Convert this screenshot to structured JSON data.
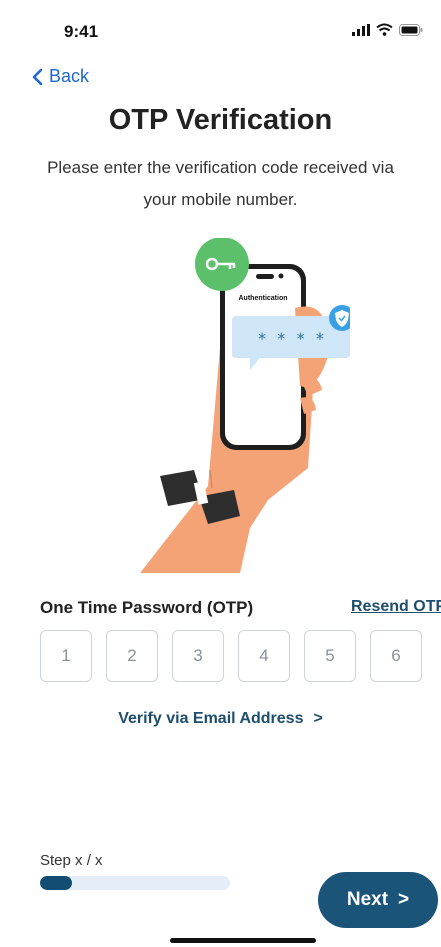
{
  "status_bar": {
    "time": "9:41"
  },
  "nav": {
    "back_label": "Back"
  },
  "header": {
    "title": "OTP Verification",
    "subtitle": "Please enter the verification code received via your mobile number."
  },
  "illustration": {
    "screen_title": "Authentication",
    "masked_code": "* * * *"
  },
  "otp": {
    "label": "One Time Password (OTP)",
    "resend_label": "Resend OTP",
    "digits": [
      "1",
      "2",
      "3",
      "4",
      "5",
      "6"
    ]
  },
  "verify_email": {
    "label": "Verify via Email Address",
    "chevron": ">"
  },
  "footer": {
    "step_label": "Step x / x",
    "progress": 0.17,
    "next_label": "Next",
    "next_chevron": ">"
  },
  "colors": {
    "accent": "#1a5478",
    "link": "#1e66d1",
    "key_badge": "#5cc06a",
    "shield_badge": "#3aa0e6"
  }
}
